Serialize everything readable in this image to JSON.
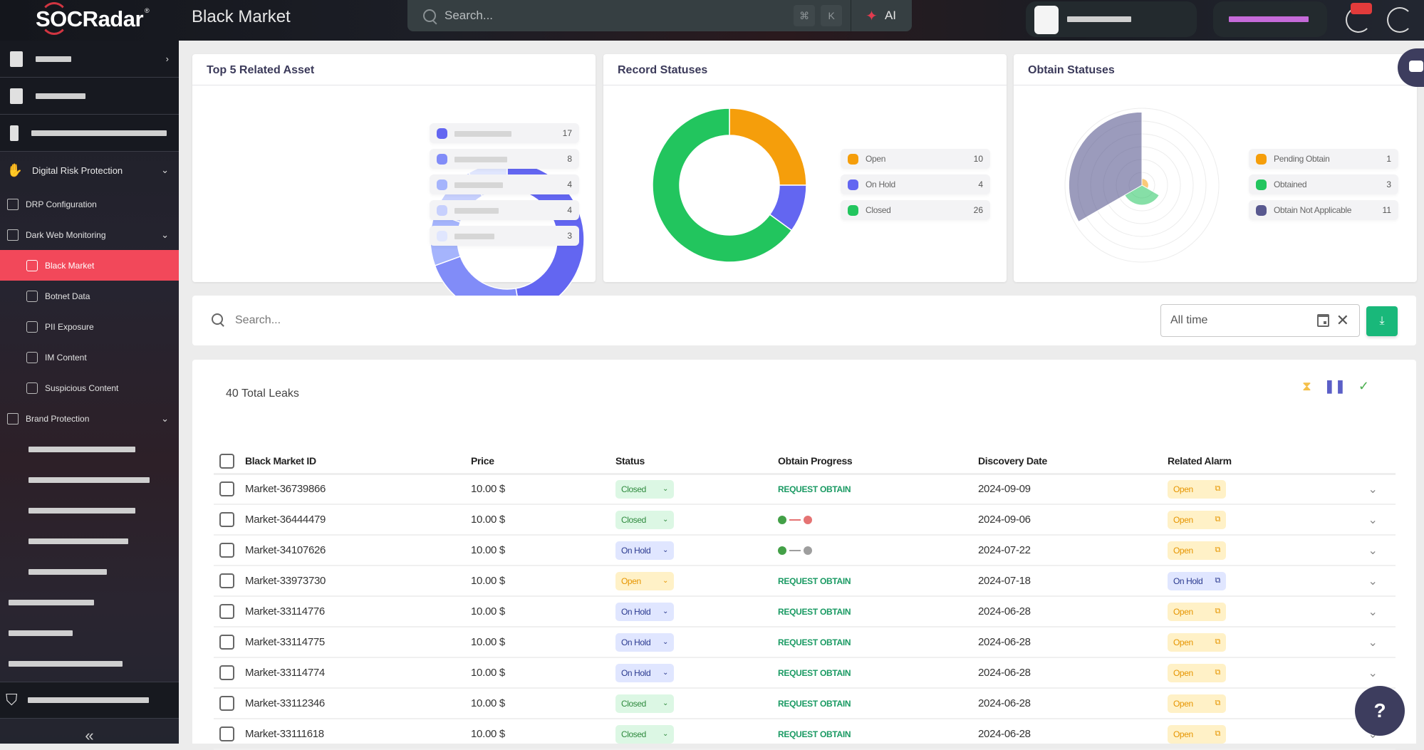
{
  "app": {
    "brand": "SOCRadar",
    "page_title": "Black Market"
  },
  "topbar": {
    "search_placeholder": "Search...",
    "kbd_cmd": "⌘",
    "kbd_k": "K",
    "ai_label": "AI",
    "ai_icon": "sparkle-icon"
  },
  "sidebar": {
    "sections": [
      {
        "label": "Digital Risk Protection",
        "icon": "hand-shield-icon",
        "expanded": true
      }
    ],
    "items": [
      {
        "label": "DRP Configuration",
        "icon": "monitor-icon"
      },
      {
        "label": "Dark Web Monitoring",
        "icon": "dark-web-icon",
        "expanded": true
      }
    ],
    "subitems": [
      {
        "label": "Black Market",
        "icon": "black-market-icon",
        "active": true
      },
      {
        "label": "Botnet Data",
        "icon": "botnet-icon",
        "active": false
      },
      {
        "label": "PII Exposure",
        "icon": "id-card-icon",
        "active": false
      },
      {
        "label": "IM Content",
        "icon": "chat-icon",
        "active": false
      },
      {
        "label": "Suspicious Content",
        "icon": "document-icon",
        "active": false
      }
    ],
    "brand_protection": {
      "label": "Brand Protection",
      "icon": "brand-icon"
    },
    "collapse_label": "«"
  },
  "charts": {
    "top5": {
      "title": "Top 5 Related Asset"
    },
    "record": {
      "title": "Record Statuses"
    },
    "obtain": {
      "title": "Obtain Statuses"
    }
  },
  "chart_data": [
    {
      "type": "pie",
      "title": "Top 5 Related Asset",
      "donut": true,
      "categories": [
        "[redacted]",
        "[redacted]",
        "[redacted]",
        "[redacted]",
        "[redacted]"
      ],
      "values": [
        17,
        8,
        4,
        4,
        3
      ],
      "colors": [
        "#6366f1",
        "#818cf8",
        "#a5b4fc",
        "#c7d0fd",
        "#e0e6fe"
      ],
      "legend": "right"
    },
    {
      "type": "pie",
      "title": "Record Statuses",
      "donut": true,
      "categories": [
        "Open",
        "On Hold",
        "Closed"
      ],
      "values": [
        10,
        4,
        26
      ],
      "colors": [
        "#f59e0b",
        "#6366f1",
        "#22c55e"
      ],
      "legend": "right"
    },
    {
      "type": "pie",
      "title": "Obtain Statuses",
      "subtype": "polar-area",
      "categories": [
        "Pending Obtain",
        "Obtained",
        "Obtain Not Applicable"
      ],
      "values": [
        1,
        3,
        11
      ],
      "colors": [
        "#f59e0b",
        "#22c55e",
        "#58588f"
      ],
      "legend": "right"
    }
  ],
  "filter": {
    "search_placeholder": "Search...",
    "date_value": "All time",
    "download_icon": "download-icon"
  },
  "table": {
    "total_label": "40 Total Leaks",
    "header_icons": [
      "hourglass-icon",
      "pause-icon",
      "check-icon"
    ],
    "columns": [
      "Black Market ID",
      "Price",
      "Status",
      "Obtain Progress",
      "Discovery Date",
      "Related Alarm"
    ],
    "rows": [
      {
        "id": "Market-36739866",
        "price": "10.00 $",
        "status": "Closed",
        "progress": "REQUEST OBTAIN",
        "date": "2024-09-09",
        "alarm": "Open"
      },
      {
        "id": "Market-36444479",
        "price": "10.00 $",
        "status": "Closed",
        "progress": "green-red",
        "date": "2024-09-06",
        "alarm": "Open"
      },
      {
        "id": "Market-34107626",
        "price": "10.00 $",
        "status": "On Hold",
        "progress": "green-gray",
        "date": "2024-07-22",
        "alarm": "Open"
      },
      {
        "id": "Market-33973730",
        "price": "10.00 $",
        "status": "Open",
        "progress": "REQUEST OBTAIN",
        "date": "2024-07-18",
        "alarm": "On Hold"
      },
      {
        "id": "Market-33114776",
        "price": "10.00 $",
        "status": "On Hold",
        "progress": "REQUEST OBTAIN",
        "date": "2024-06-28",
        "alarm": "Open"
      },
      {
        "id": "Market-33114775",
        "price": "10.00 $",
        "status": "On Hold",
        "progress": "REQUEST OBTAIN",
        "date": "2024-06-28",
        "alarm": "Open"
      },
      {
        "id": "Market-33114774",
        "price": "10.00 $",
        "status": "On Hold",
        "progress": "REQUEST OBTAIN",
        "date": "2024-06-28",
        "alarm": "Open"
      },
      {
        "id": "Market-33112346",
        "price": "10.00 $",
        "status": "Closed",
        "progress": "REQUEST OBTAIN",
        "date": "2024-06-28",
        "alarm": "Open"
      },
      {
        "id": "Market-33111618",
        "price": "10.00 $",
        "status": "Closed",
        "progress": "REQUEST OBTAIN",
        "date": "2024-06-28",
        "alarm": "Open"
      }
    ]
  },
  "colors": {
    "accent": "#f2485a",
    "download": "#19b87a",
    "request_obtain": "#1a9a63"
  },
  "help": {
    "icon": "help-chat-icon"
  }
}
